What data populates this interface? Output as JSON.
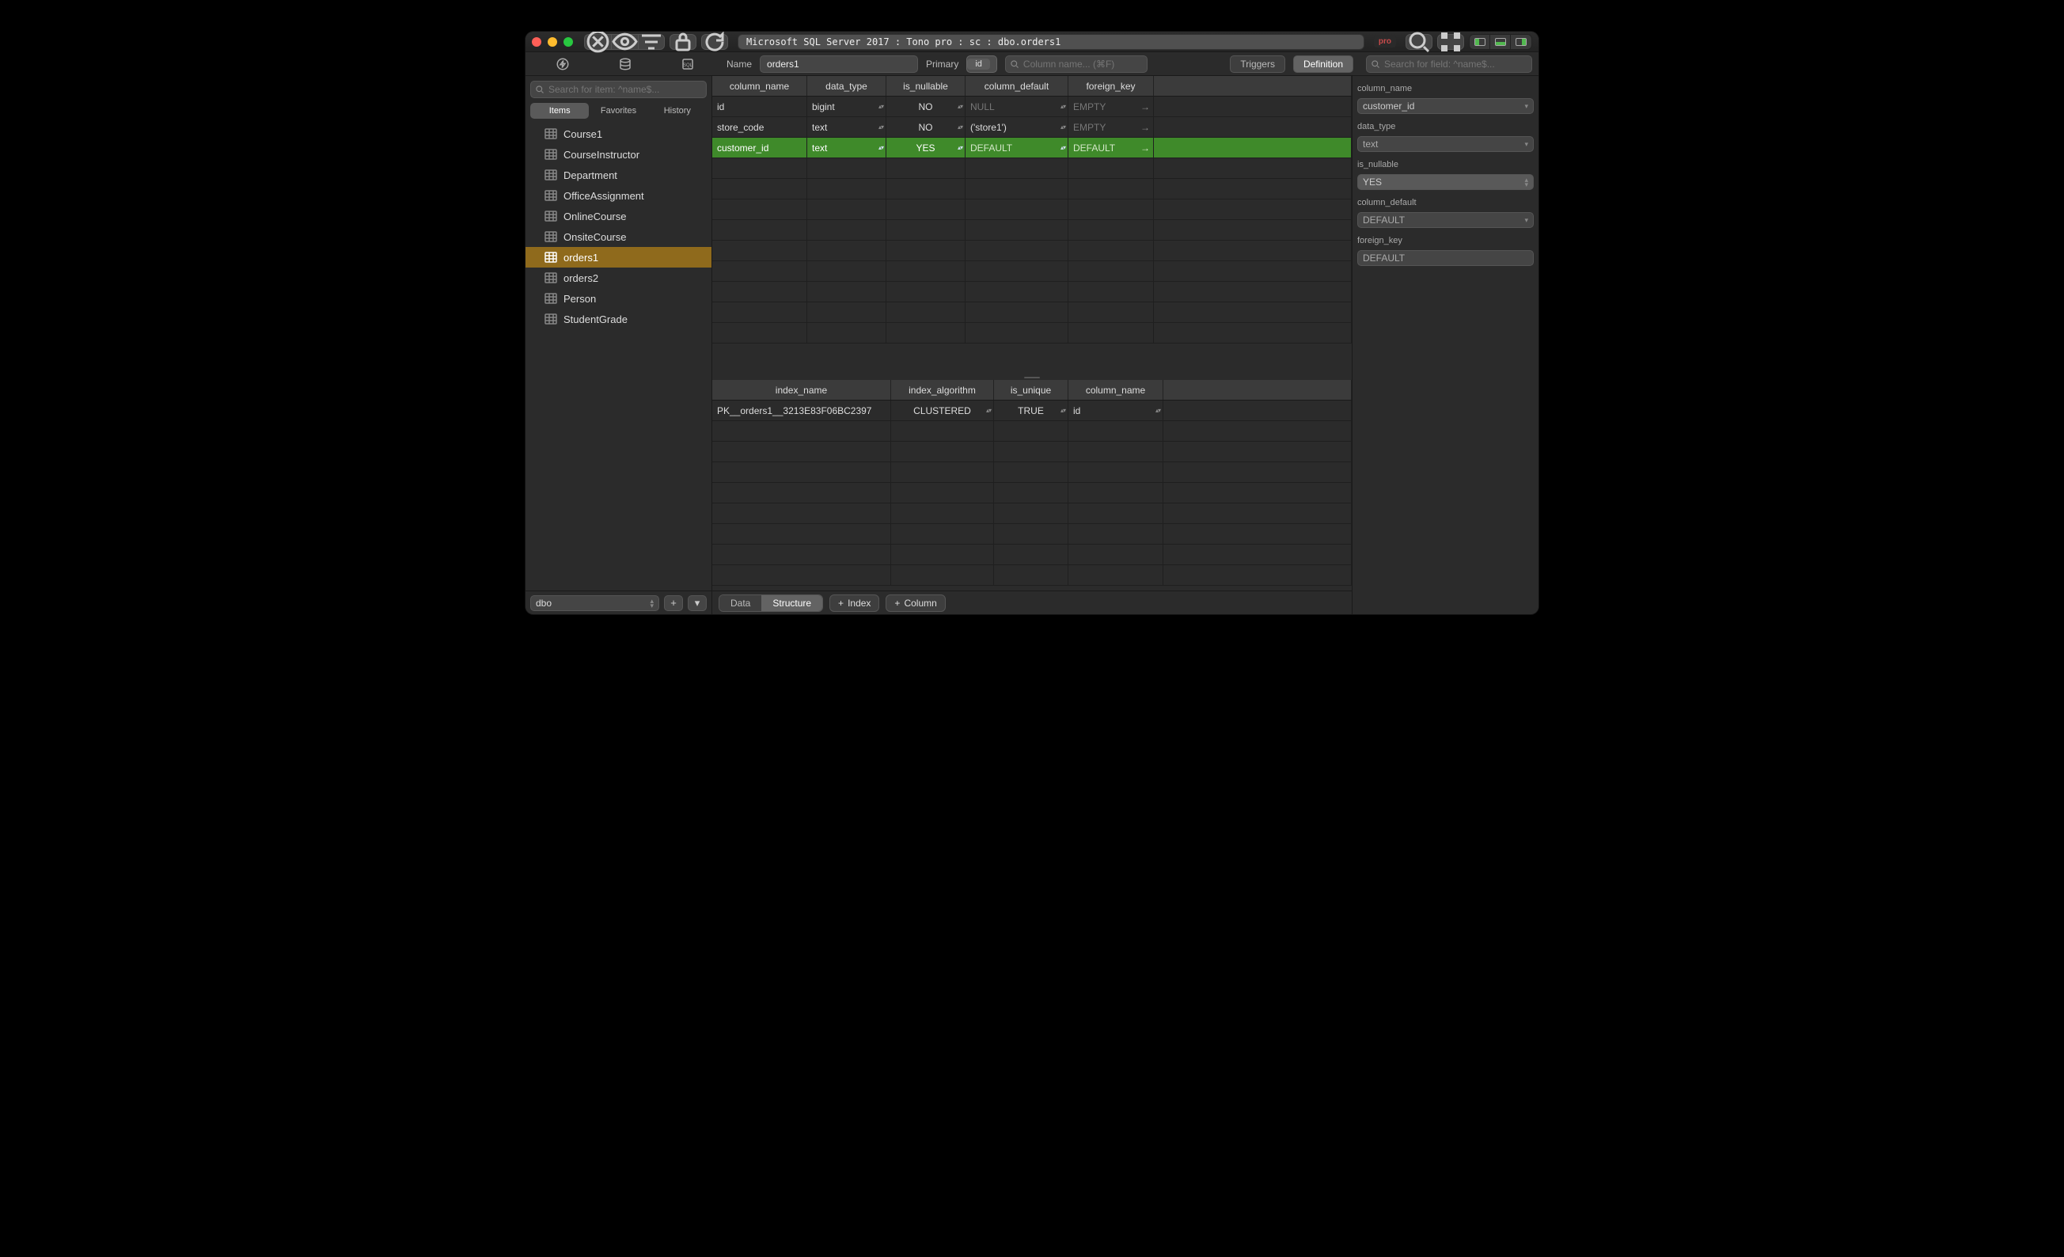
{
  "titlebar": {
    "breadcrumb": "Microsoft SQL Server 2017 : Tono pro : sc : dbo.orders1",
    "pro": "pro"
  },
  "subheader": {
    "name_label": "Name",
    "name_value": "orders1",
    "primary_label": "Primary",
    "primary_chip": "id",
    "column_search_ph": "Column name... (⌘F)",
    "triggers": "Triggers",
    "definition": "Definition",
    "field_search_ph": "Search for field: ^name$..."
  },
  "sidebar": {
    "search_ph": "Search for item: ^name$...",
    "tabs": {
      "items": "Items",
      "fav": "Favorites",
      "hist": "History"
    },
    "tables": [
      {
        "name": "Course1"
      },
      {
        "name": "CourseInstructor"
      },
      {
        "name": "Department"
      },
      {
        "name": "OfficeAssignment"
      },
      {
        "name": "OnlineCourse"
      },
      {
        "name": "OnsiteCourse"
      },
      {
        "name": "orders1",
        "selected": true
      },
      {
        "name": "orders2"
      },
      {
        "name": "Person"
      },
      {
        "name": "StudentGrade"
      }
    ],
    "schema": "dbo"
  },
  "columns": {
    "headers": {
      "name": "column_name",
      "type": "data_type",
      "null": "is_nullable",
      "def": "column_default",
      "fk": "foreign_key"
    },
    "rows": [
      {
        "name": "id",
        "type": "bigint",
        "null": "NO",
        "def": "NULL",
        "def_muted": true,
        "fk": "EMPTY",
        "fk_muted": true
      },
      {
        "name": "store_code",
        "type": "text",
        "null": "NO",
        "def": "('store1')",
        "fk": "EMPTY",
        "fk_muted": true
      },
      {
        "name": "customer_id",
        "type": "text",
        "null": "YES",
        "def": "DEFAULT",
        "def_muted": true,
        "fk": "DEFAULT",
        "fk_muted": true,
        "selected": true
      }
    ]
  },
  "indexes": {
    "headers": {
      "name": "index_name",
      "algo": "index_algorithm",
      "uniq": "is_unique",
      "col": "column_name"
    },
    "rows": [
      {
        "name": "PK__orders1__3213E83F06BC2397",
        "algo": "CLUSTERED",
        "uniq": "TRUE",
        "col": "id"
      }
    ]
  },
  "main_foot": {
    "data": "Data",
    "structure": "Structure",
    "index": "Index",
    "column": "Column"
  },
  "inspector": {
    "column_name_l": "column_name",
    "column_name_v": "customer_id",
    "data_type_l": "data_type",
    "data_type_v": "text",
    "is_nullable_l": "is_nullable",
    "is_nullable_v": "YES",
    "column_default_l": "column_default",
    "column_default_v": "DEFAULT",
    "foreign_key_l": "foreign_key",
    "foreign_key_v": "DEFAULT"
  }
}
